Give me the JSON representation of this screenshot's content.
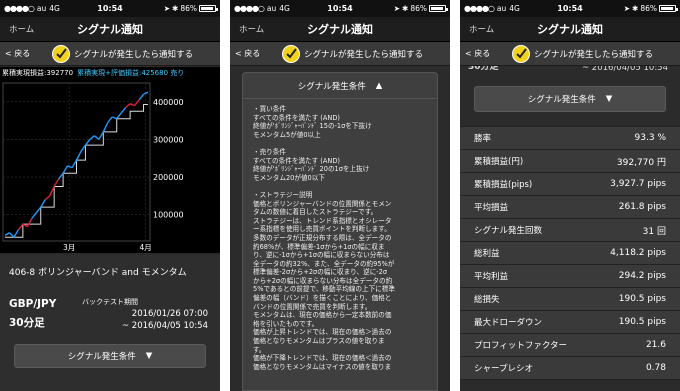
{
  "status": {
    "carrier": "au",
    "network": "4G",
    "time": "10:54",
    "battery": "86%",
    "battery_fraction": 0.86
  },
  "nav": {
    "home": "ホーム",
    "title": "シグナル通知"
  },
  "subbar": {
    "back": "< 戻る",
    "notify": "シグナルが発生したら通知する"
  },
  "chart": {
    "header_realized": "累積実現損益:392770",
    "header_total": "累積実現+評価損益:425680 売り"
  },
  "chart_data": {
    "type": "line",
    "y_ticks": [
      "400000",
      "300000",
      "200000",
      "100000"
    ],
    "x_ticks": [
      "3月",
      "4月"
    ],
    "ylim": [
      30000,
      450000
    ],
    "series": [
      {
        "values": [
          45000,
          52000,
          40000,
          60000,
          75000,
          68000,
          90000,
          105000,
          120000,
          140000,
          150000,
          175000,
          195000,
          210000,
          230000,
          225000,
          245000,
          268000,
          285000,
          300000,
          310000,
          300000,
          320000,
          345000,
          360000,
          355000,
          370000,
          385000,
          395000,
          390000,
          405000,
          420000,
          425680
        ]
      },
      {
        "values": [
          40000,
          40000,
          40000,
          40000,
          75000,
          75000,
          75000,
          75000,
          120000,
          120000,
          120000,
          175000,
          175000,
          210000,
          210000,
          210000,
          245000,
          245000,
          285000,
          285000,
          285000,
          285000,
          320000,
          320000,
          320000,
          355000,
          355000,
          355000,
          375000,
          375000,
          375000,
          392770,
          392770
        ]
      }
    ]
  },
  "strategy": {
    "name": "406-8 ボリンジャーバンド and モメンタム",
    "pair": "GBP/JPY",
    "timeframe": "30分足",
    "period_label": "バックテスト期間",
    "date_from": "2016/01/26 07:00",
    "date_to": "~ 2016/04/05 10:54"
  },
  "conditions": {
    "button_label": "シグナル発生条件",
    "text": "・買い条件\nすべての条件を満たす (AND)\n終値が'ﾎﾞﾘﾝｼﾞｬｰﾊﾞﾝﾄﾞ 15の-1σを下抜け\nモメンタム5が値0以上\n\n・売り条件\nすべての条件を満たす (AND)\n終値が'ﾎﾞﾘﾝｼﾞｬｰﾊﾞﾝﾄﾞ 20の1σを上抜け\nモメンタム20が値0以下\n\n・ストラテジー説明\n価格とボリンジャーバンドの位置関係とモメン\nタムの数値に着目したストラテジーです。\nストラテジーは、トレンド系指標とオシレータ\nー系指標を使用し売買ポイントを判断します。\n多数のデータが正規分布する際は、全データの\n約68%が、標準偏差-1σから+1σの幅に収ま\nり、逆に-1σから+1σの幅に収まらない分布は\n全データの約32%、また、全データの約95%が\n標準偏差-2σから+2σの幅に収まり、逆に-2σ\nから+2σの幅に収まらない分布は全データの約\n5%であるとの前提で、移動平均線の上下に標準\n偏差の幅（バンド）を描くことにより、価格と\nバンドの位置関係で売買を判断します。\nモメンタムは、現在の価格から一定本数前の価\n格を引いたものです。\n価格が上昇トレンドでは、現在の価格＞過去の\n価格となりモメンタムはプラスの値を取りま\nす。\n価格が下降トレンドでは、現在の価格＜過去の\n価格となりモメンタムはマイナスの値を取りま"
  },
  "panel3": {
    "clipped_tf": "30分足",
    "clipped_date": "~ 2016/04/05 10:54"
  },
  "stats": [
    {
      "label": "勝率",
      "value": "93.3 %"
    },
    {
      "label": "累積損益(円)",
      "value": "392,770 円"
    },
    {
      "label": "累積損益(pips)",
      "value": "3,927.7 pips"
    },
    {
      "label": "平均損益",
      "value": "261.8 pips"
    },
    {
      "label": "シグナル発生回数",
      "value": "31 回"
    },
    {
      "label": "総利益",
      "value": "4,118.2 pips"
    },
    {
      "label": "平均利益",
      "value": "294.2 pips"
    },
    {
      "label": "総損失",
      "value": "190.5 pips"
    },
    {
      "label": "最大ドローダウン",
      "value": "190.5 pips"
    },
    {
      "label": "プロフィットファクター",
      "value": "21.6"
    },
    {
      "label": "シャープレシオ",
      "value": "0.78"
    }
  ]
}
